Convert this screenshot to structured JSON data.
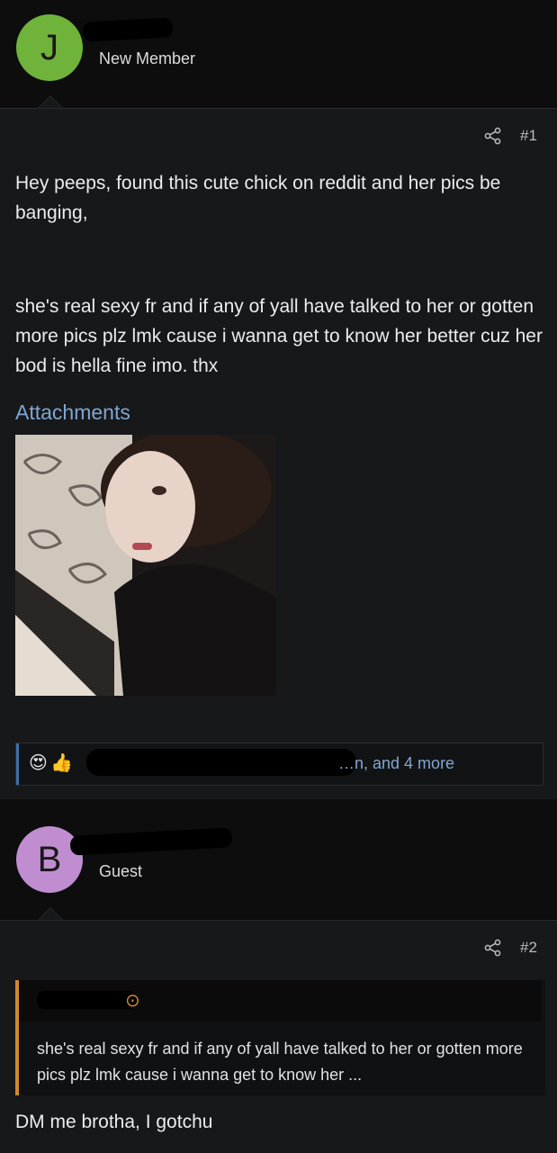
{
  "posts": [
    {
      "author": {
        "initial": "J",
        "avatar_color": "#6fb33a",
        "title": "New Member"
      },
      "post_number": "#1",
      "message": [
        "Hey peeps, found this cute chick on reddit and her pics be banging,",
        "she's real sexy fr and if any of yall have talked to her or gotten more pics plz lmk cause i wanna get to know her better cuz her bod is hella fine imo. thx"
      ],
      "attachments_label": "Attachments",
      "reactions": {
        "emojis": [
          "😍",
          "👍"
        ],
        "summary_visible": "…n, and 4 more"
      }
    },
    {
      "author": {
        "initial": "B",
        "avatar_color": "#c08ed0",
        "title": "Guest"
      },
      "post_number": "#2",
      "quote": {
        "text": "she's real sexy fr and if any of yall have talked to her or gotten more pics plz lmk cause i wanna get to know her ..."
      },
      "message": "DM me brotha, I gotchu"
    }
  ],
  "colors": {
    "accent_link": "#7fa6d2",
    "quote_border": "#d08a2a",
    "background": "#0d0d0e",
    "post_bg": "#17181a"
  }
}
